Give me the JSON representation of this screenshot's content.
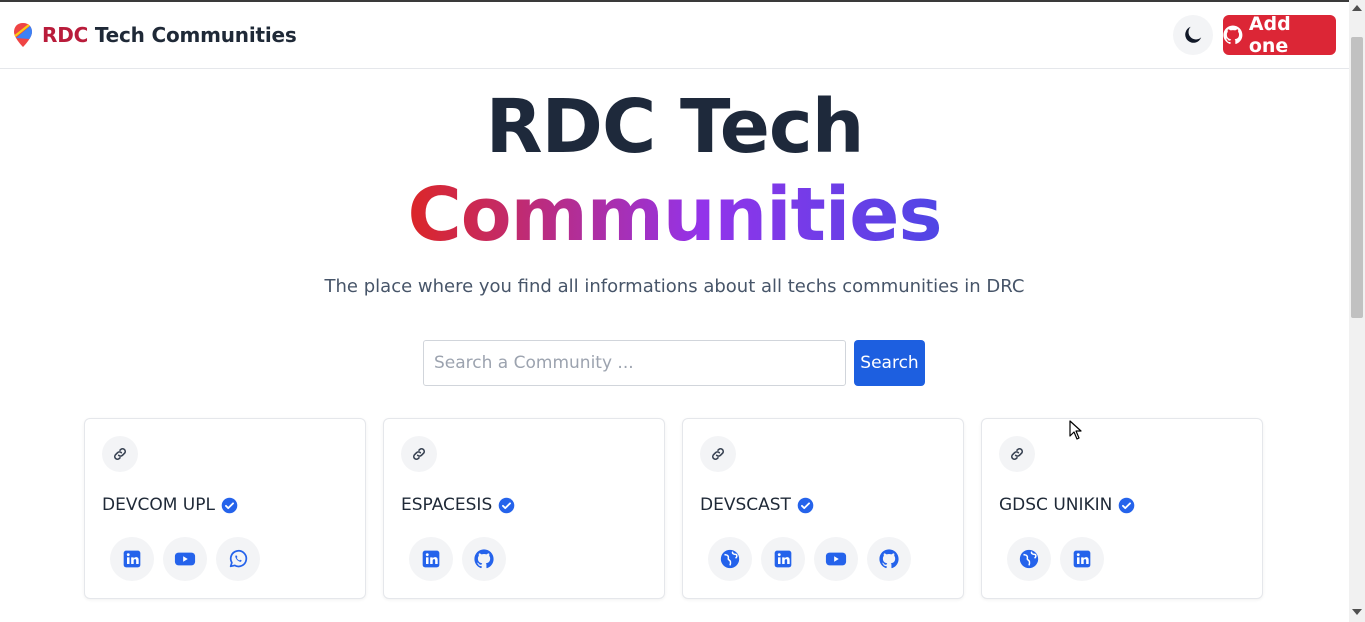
{
  "nav": {
    "brand_highlight": "RDC",
    "brand_rest": "Tech Communities",
    "add_label": "Add one"
  },
  "hero": {
    "line1": "RDC Tech",
    "line2": "Communities",
    "subtitle": "The place where you find all informations about all techs communities in DRC"
  },
  "search": {
    "placeholder": "Search a Community ...",
    "button_label": "Search"
  },
  "colors": {
    "brand_red": "#dc2636",
    "primary_blue": "#1d5fe0",
    "verified_blue": "#2563eb",
    "social_icon_blue": "#2563eb"
  },
  "communities": [
    {
      "name": "DEVCOM UPL",
      "verified": true,
      "socials": [
        "linkedin-icon",
        "youtube-icon",
        "whatsapp-icon"
      ]
    },
    {
      "name": "ESPACESIS",
      "verified": true,
      "socials": [
        "linkedin-icon",
        "github-icon"
      ]
    },
    {
      "name": "DEVSCAST",
      "verified": true,
      "socials": [
        "globe-icon",
        "linkedin-icon",
        "youtube-icon",
        "github-icon"
      ]
    },
    {
      "name": "GDSC UNIKIN",
      "verified": true,
      "socials": [
        "globe-icon",
        "linkedin-icon"
      ]
    }
  ]
}
